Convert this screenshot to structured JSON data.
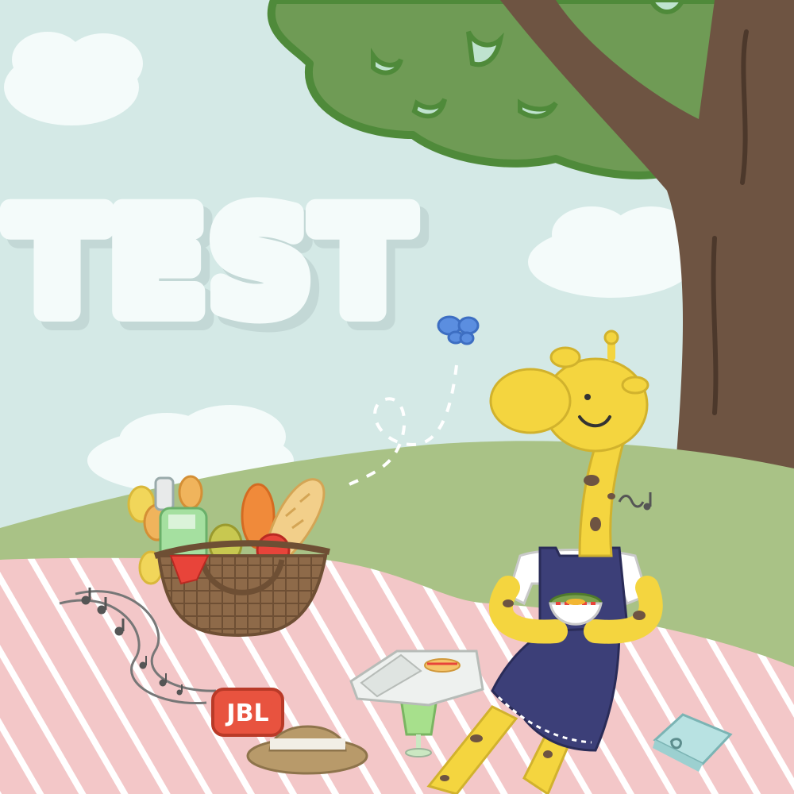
{
  "scene": {
    "sky_text": "TEST",
    "speaker_brand": "JBL",
    "colors": {
      "sky": "#d4e9e6",
      "cloud": "#f4fbfa",
      "cloud_shadow": "#c3d8d6",
      "hill": "#a9c286",
      "leaves": "#6f9b55",
      "leaves_edge": "#4f8a3a",
      "trunk": "#6e5442",
      "blanket": "#f3c7c8",
      "blanket_stripe": "#ffffff",
      "giraffe": "#f4d53f",
      "giraffe_spot": "#6e5442",
      "overalls": "#3c3f78",
      "speaker": "#e8533f",
      "butterfly": "#5b8ee0",
      "basket": "#8e6a49"
    },
    "icons": [
      "tree",
      "clouds",
      "butterfly",
      "music-notes",
      "picnic-basket",
      "bread",
      "bottle",
      "tulips",
      "giraffe",
      "bowl",
      "bluetooth-speaker",
      "straw-hat",
      "cream-soda-glass",
      "sandwich-box",
      "book"
    ]
  }
}
